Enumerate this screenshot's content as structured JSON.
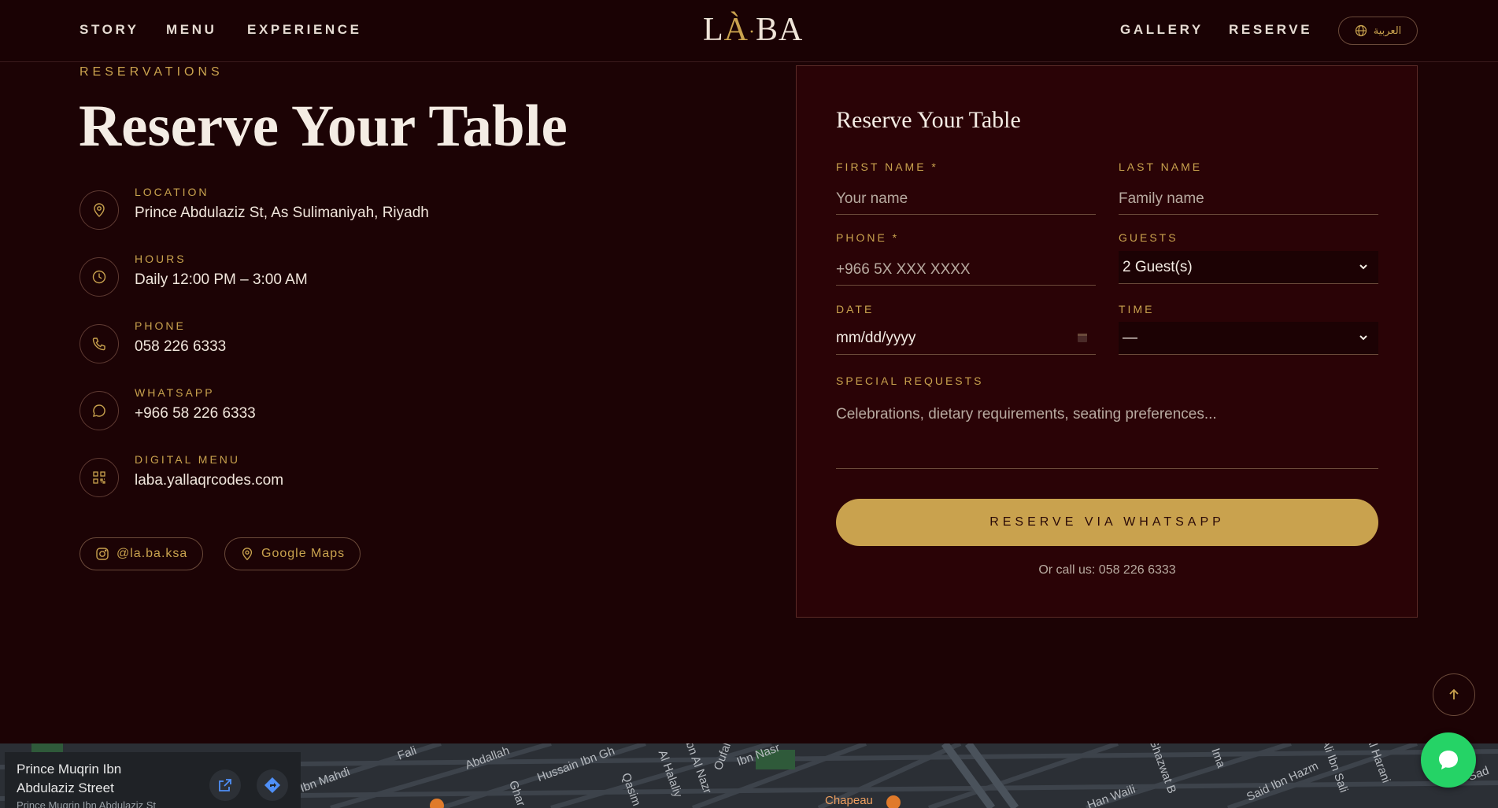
{
  "header": {
    "nav_left": [
      "STORY",
      "MENU",
      "EXPERIENCE"
    ],
    "nav_right": [
      "GALLERY",
      "RESERVE"
    ],
    "logo": {
      "pre": "L",
      "accent": "À",
      "dot": "·",
      "post": "BA"
    },
    "language_button": "العربية"
  },
  "section": {
    "eyebrow": "RESERVATIONS",
    "title": "Reserve Your Table"
  },
  "info": [
    {
      "label": "LOCATION",
      "value": "Prince Abdulaziz St, As Sulimaniyah, Riyadh",
      "icon": "location-pin-icon"
    },
    {
      "label": "HOURS",
      "value": "Daily 12:00 PM – 3:00 AM",
      "icon": "clock-icon"
    },
    {
      "label": "PHONE",
      "value": "058 226 6333",
      "icon": "phone-icon"
    },
    {
      "label": "WHATSAPP",
      "value": "+966 58 226 6333",
      "icon": "chat-bubble-icon"
    },
    {
      "label": "DIGITAL MENU",
      "value": "laba.yallaqrcodes.com",
      "icon": "qr-code-icon"
    }
  ],
  "links": {
    "instagram": "@la.ba.ksa",
    "maps": "Google Maps"
  },
  "form": {
    "title": "Reserve Your Table",
    "first_name_label": "FIRST NAME *",
    "first_name_placeholder": "Your name",
    "last_name_label": "LAST NAME",
    "last_name_placeholder": "Family name",
    "phone_label": "PHONE *",
    "phone_placeholder": "+966 5X XXX XXXX",
    "guests_label": "GUESTS",
    "guests_value": "2 Guest(s)",
    "date_label": "DATE",
    "date_placeholder": "mm/dd/yyyy",
    "time_label": "TIME",
    "time_value": "—",
    "requests_label": "SPECIAL REQUESTS",
    "requests_placeholder": "Celebrations, dietary requirements, seating preferences...",
    "submit": "RESERVE VIA WHATSAPP",
    "call_note": "Or call us: 058 226 6333"
  },
  "map": {
    "place_name": "Prince Muqrin Ibn Abdulaziz Street",
    "place_sub": "Prince Muqrin Ibn Abdulaziz St",
    "streets": [
      "Ibn Mahdi",
      "Abdallah",
      "Hussain Ibn Gh",
      "Al Halaliy",
      "Ibn Al Nazr",
      "Oufal",
      "Ibn Nasr",
      "Chapeau",
      "Han Waili",
      "Ghazwat B",
      "Said Ibn Hazm",
      "Ali Ibn Sali",
      "Al Harani",
      "Sad",
      "Qasim",
      "Fali",
      "Ghar",
      "Ima"
    ]
  },
  "colors": {
    "background": "#1c0305",
    "card": "#2a0306",
    "gold": "#c9a24e",
    "whatsapp": "#25d366"
  }
}
